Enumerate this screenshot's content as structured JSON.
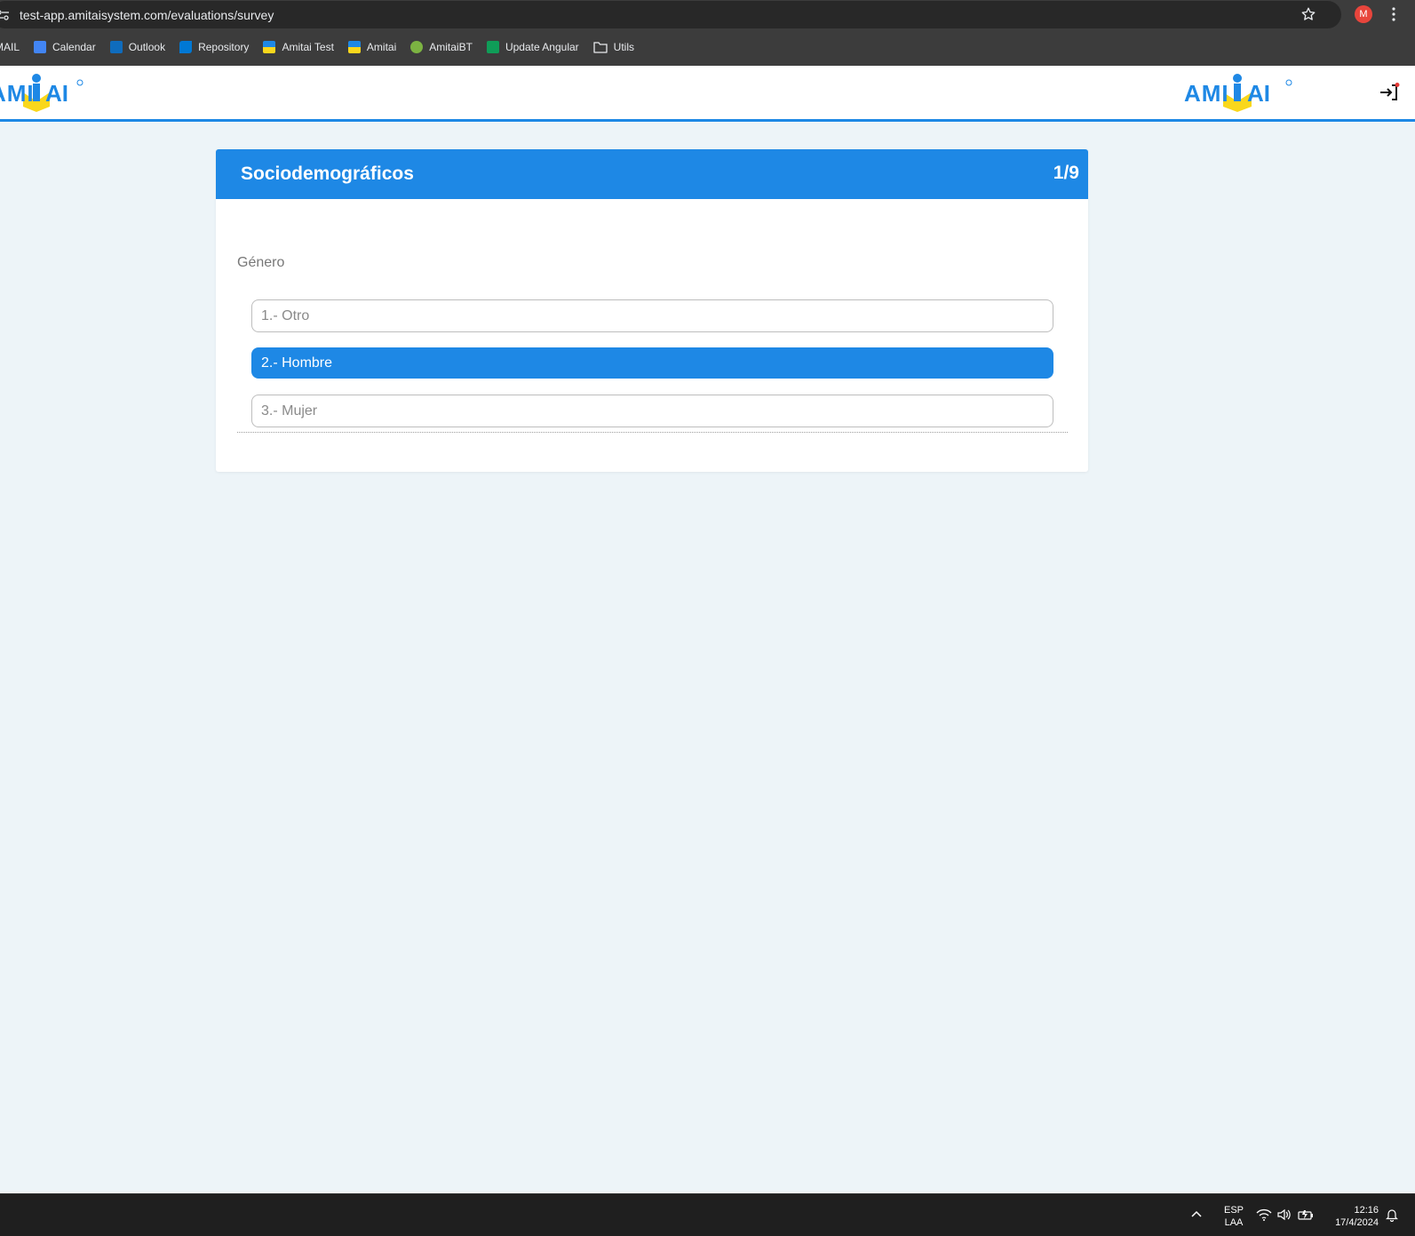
{
  "browser": {
    "url": "test-app.amitaisystem.com/evaluations/survey",
    "avatar_letter": "M",
    "bookmarks": [
      {
        "label": "MAIL",
        "icon": "mail-icon"
      },
      {
        "label": "Calendar",
        "icon": "calendar-icon"
      },
      {
        "label": "Outlook",
        "icon": "outlook-icon"
      },
      {
        "label": "Repository",
        "icon": "azure-devops-icon"
      },
      {
        "label": "Amitai Test",
        "icon": "amitai-icon"
      },
      {
        "label": "Amitai",
        "icon": "amitai-icon"
      },
      {
        "label": "AmitaiBT",
        "icon": "amitaibt-icon"
      },
      {
        "label": "Update Angular",
        "icon": "sheet-icon"
      },
      {
        "label": "Utils",
        "icon": "folder-icon"
      }
    ]
  },
  "header": {
    "logo_text": "AMITAI",
    "brand_color": "#1e88e5",
    "logo_accent": "#f9d71c"
  },
  "survey": {
    "section_title": "Sociodemográficos",
    "progress": "1/9",
    "question": "Género",
    "options": [
      {
        "label": "1.- Otro",
        "selected": false
      },
      {
        "label": "2.- Hombre",
        "selected": true
      },
      {
        "label": "3.- Mujer",
        "selected": false
      }
    ]
  },
  "taskbar": {
    "lang_line1": "ESP",
    "lang_line2": "LAA",
    "time": "12:16",
    "date": "17/4/2024"
  }
}
